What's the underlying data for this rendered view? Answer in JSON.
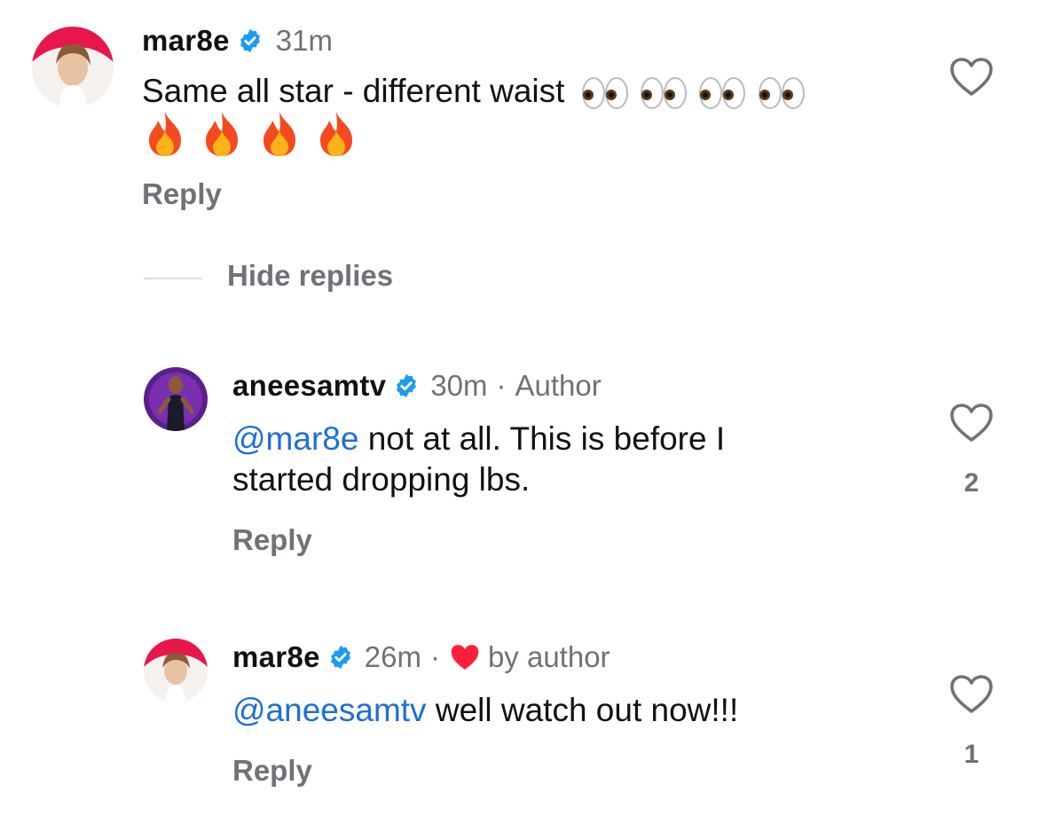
{
  "comment1": {
    "username": "mar8e",
    "time": "31m",
    "text": "Same all star - different waist",
    "reply_label": "Reply"
  },
  "hide_replies_label": "Hide replies",
  "reply1": {
    "username": "aneesamtv",
    "time": "30m",
    "separator": "·",
    "badge": "Author",
    "mention": "@mar8e",
    "text_line1": " not at all. This is before I",
    "text_line2": "started dropping lbs.",
    "reply_label": "Reply",
    "like_count": "2"
  },
  "reply2": {
    "username": "mar8e",
    "time": "26m",
    "separator": "·",
    "liked_by": "by author",
    "mention": "@aneesamtv",
    "text": " well watch out now!!!",
    "reply_label": "Reply",
    "like_count": "1"
  },
  "colors": {
    "verified": "#1d9bf0",
    "mention": "#1e6fd6",
    "secondary": "#6f7277",
    "heart_red": "#ff1f3d"
  }
}
